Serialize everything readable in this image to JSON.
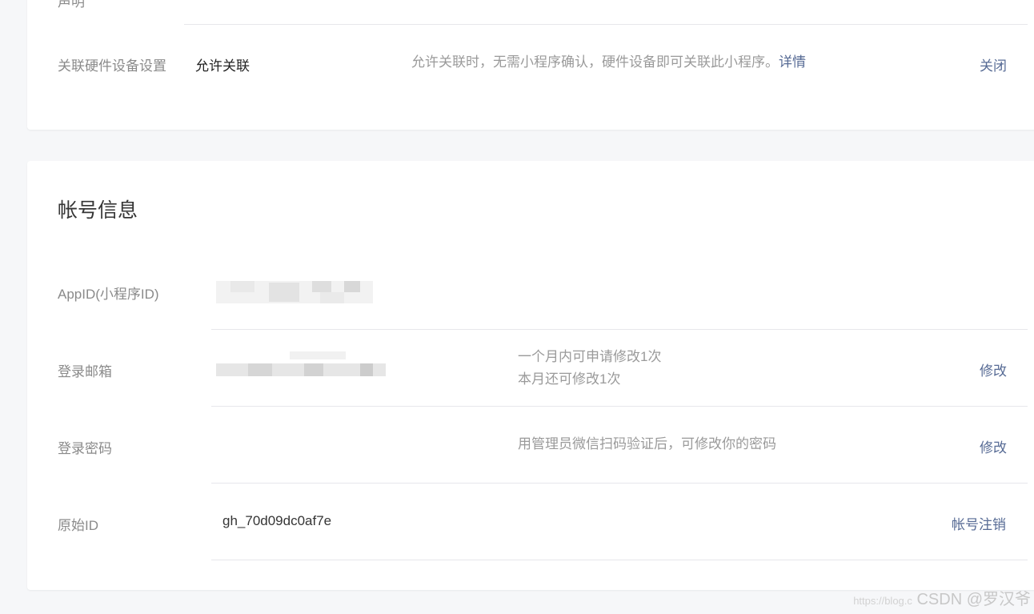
{
  "top_section": {
    "partial_label": "声明",
    "hardware": {
      "label": "关联硬件设备设置",
      "value": "允许关联",
      "description": "允许关联时，无需小程序确认，硬件设备即可关联此小程序。",
      "details_link": "详情",
      "action": "关闭"
    }
  },
  "account": {
    "title": "帐号信息",
    "rows": [
      {
        "label": "AppID(小程序ID)"
      },
      {
        "label": "登录邮箱",
        "note_line1": "一个月内可申请修改1次",
        "note_line2": "本月还可修改1次",
        "action": "修改"
      },
      {
        "label": "登录密码",
        "note": "用管理员微信扫码验证后，可修改你的密码",
        "action": "修改"
      },
      {
        "label": "原始ID",
        "value": "gh_70d09dc0af7e",
        "action": "帐号注销"
      }
    ]
  },
  "watermark": {
    "url_part": "https://blog.c",
    "text": "CSDN @罗汉爷"
  },
  "colors": {
    "link": "#576b95",
    "background": "#f6f7f9",
    "label": "#8a8a8a"
  }
}
